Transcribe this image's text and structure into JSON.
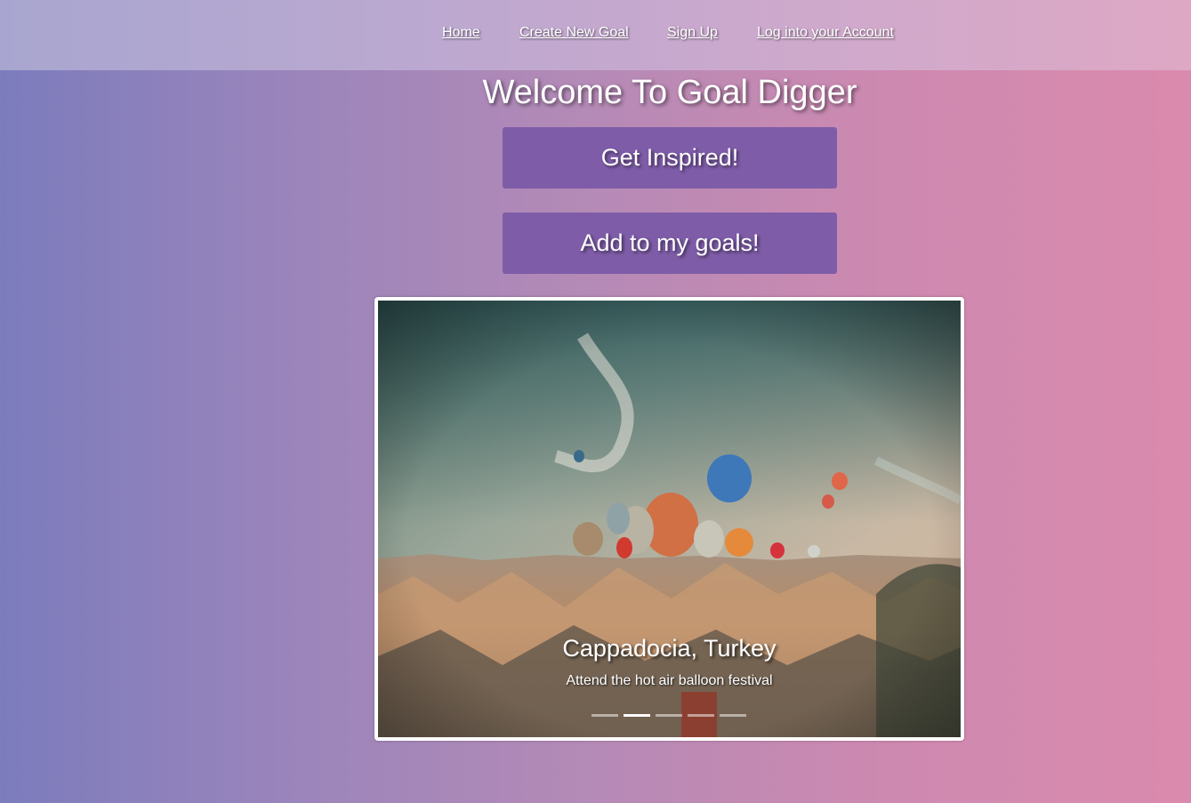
{
  "nav": {
    "items": [
      {
        "label": "Home"
      },
      {
        "label": "Create New Goal"
      },
      {
        "label": "Sign Up"
      },
      {
        "label": "Log into your Account"
      }
    ]
  },
  "main": {
    "title": "Welcome To Goal Digger",
    "inspire_button": "Get Inspired!",
    "add_button": "Add to my goals!"
  },
  "carousel": {
    "slide_title": "Cappadocia, Turkey",
    "slide_text": "Attend the hot air balloon festival",
    "slide_count": 5,
    "active_slide": 2
  },
  "colors": {
    "button": "#7e5ca8",
    "background_left": "#7c7cbd",
    "background_right": "#da8aad"
  }
}
